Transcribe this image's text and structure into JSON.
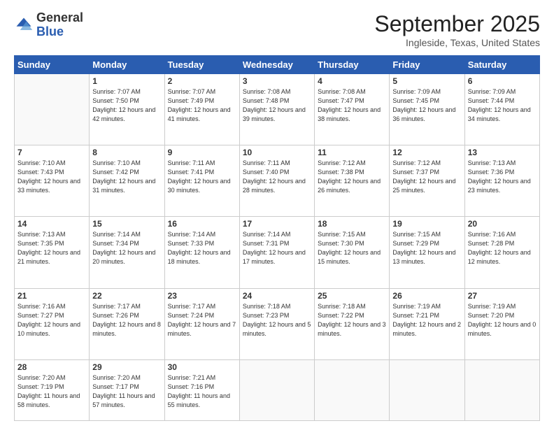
{
  "logo": {
    "general": "General",
    "blue": "Blue"
  },
  "title": "September 2025",
  "subtitle": "Ingleside, Texas, United States",
  "days_of_week": [
    "Sunday",
    "Monday",
    "Tuesday",
    "Wednesday",
    "Thursday",
    "Friday",
    "Saturday"
  ],
  "weeks": [
    [
      {
        "num": "",
        "info": ""
      },
      {
        "num": "1",
        "info": "Sunrise: 7:07 AM\nSunset: 7:50 PM\nDaylight: 12 hours\nand 42 minutes."
      },
      {
        "num": "2",
        "info": "Sunrise: 7:07 AM\nSunset: 7:49 PM\nDaylight: 12 hours\nand 41 minutes."
      },
      {
        "num": "3",
        "info": "Sunrise: 7:08 AM\nSunset: 7:48 PM\nDaylight: 12 hours\nand 39 minutes."
      },
      {
        "num": "4",
        "info": "Sunrise: 7:08 AM\nSunset: 7:47 PM\nDaylight: 12 hours\nand 38 minutes."
      },
      {
        "num": "5",
        "info": "Sunrise: 7:09 AM\nSunset: 7:45 PM\nDaylight: 12 hours\nand 36 minutes."
      },
      {
        "num": "6",
        "info": "Sunrise: 7:09 AM\nSunset: 7:44 PM\nDaylight: 12 hours\nand 34 minutes."
      }
    ],
    [
      {
        "num": "7",
        "info": "Sunrise: 7:10 AM\nSunset: 7:43 PM\nDaylight: 12 hours\nand 33 minutes."
      },
      {
        "num": "8",
        "info": "Sunrise: 7:10 AM\nSunset: 7:42 PM\nDaylight: 12 hours\nand 31 minutes."
      },
      {
        "num": "9",
        "info": "Sunrise: 7:11 AM\nSunset: 7:41 PM\nDaylight: 12 hours\nand 30 minutes."
      },
      {
        "num": "10",
        "info": "Sunrise: 7:11 AM\nSunset: 7:40 PM\nDaylight: 12 hours\nand 28 minutes."
      },
      {
        "num": "11",
        "info": "Sunrise: 7:12 AM\nSunset: 7:38 PM\nDaylight: 12 hours\nand 26 minutes."
      },
      {
        "num": "12",
        "info": "Sunrise: 7:12 AM\nSunset: 7:37 PM\nDaylight: 12 hours\nand 25 minutes."
      },
      {
        "num": "13",
        "info": "Sunrise: 7:13 AM\nSunset: 7:36 PM\nDaylight: 12 hours\nand 23 minutes."
      }
    ],
    [
      {
        "num": "14",
        "info": "Sunrise: 7:13 AM\nSunset: 7:35 PM\nDaylight: 12 hours\nand 21 minutes."
      },
      {
        "num": "15",
        "info": "Sunrise: 7:14 AM\nSunset: 7:34 PM\nDaylight: 12 hours\nand 20 minutes."
      },
      {
        "num": "16",
        "info": "Sunrise: 7:14 AM\nSunset: 7:33 PM\nDaylight: 12 hours\nand 18 minutes."
      },
      {
        "num": "17",
        "info": "Sunrise: 7:14 AM\nSunset: 7:31 PM\nDaylight: 12 hours\nand 17 minutes."
      },
      {
        "num": "18",
        "info": "Sunrise: 7:15 AM\nSunset: 7:30 PM\nDaylight: 12 hours\nand 15 minutes."
      },
      {
        "num": "19",
        "info": "Sunrise: 7:15 AM\nSunset: 7:29 PM\nDaylight: 12 hours\nand 13 minutes."
      },
      {
        "num": "20",
        "info": "Sunrise: 7:16 AM\nSunset: 7:28 PM\nDaylight: 12 hours\nand 12 minutes."
      }
    ],
    [
      {
        "num": "21",
        "info": "Sunrise: 7:16 AM\nSunset: 7:27 PM\nDaylight: 12 hours\nand 10 minutes."
      },
      {
        "num": "22",
        "info": "Sunrise: 7:17 AM\nSunset: 7:26 PM\nDaylight: 12 hours\nand 8 minutes."
      },
      {
        "num": "23",
        "info": "Sunrise: 7:17 AM\nSunset: 7:24 PM\nDaylight: 12 hours\nand 7 minutes."
      },
      {
        "num": "24",
        "info": "Sunrise: 7:18 AM\nSunset: 7:23 PM\nDaylight: 12 hours\nand 5 minutes."
      },
      {
        "num": "25",
        "info": "Sunrise: 7:18 AM\nSunset: 7:22 PM\nDaylight: 12 hours\nand 3 minutes."
      },
      {
        "num": "26",
        "info": "Sunrise: 7:19 AM\nSunset: 7:21 PM\nDaylight: 12 hours\nand 2 minutes."
      },
      {
        "num": "27",
        "info": "Sunrise: 7:19 AM\nSunset: 7:20 PM\nDaylight: 12 hours\nand 0 minutes."
      }
    ],
    [
      {
        "num": "28",
        "info": "Sunrise: 7:20 AM\nSunset: 7:19 PM\nDaylight: 11 hours\nand 58 minutes."
      },
      {
        "num": "29",
        "info": "Sunrise: 7:20 AM\nSunset: 7:17 PM\nDaylight: 11 hours\nand 57 minutes."
      },
      {
        "num": "30",
        "info": "Sunrise: 7:21 AM\nSunset: 7:16 PM\nDaylight: 11 hours\nand 55 minutes."
      },
      {
        "num": "",
        "info": ""
      },
      {
        "num": "",
        "info": ""
      },
      {
        "num": "",
        "info": ""
      },
      {
        "num": "",
        "info": ""
      }
    ]
  ]
}
